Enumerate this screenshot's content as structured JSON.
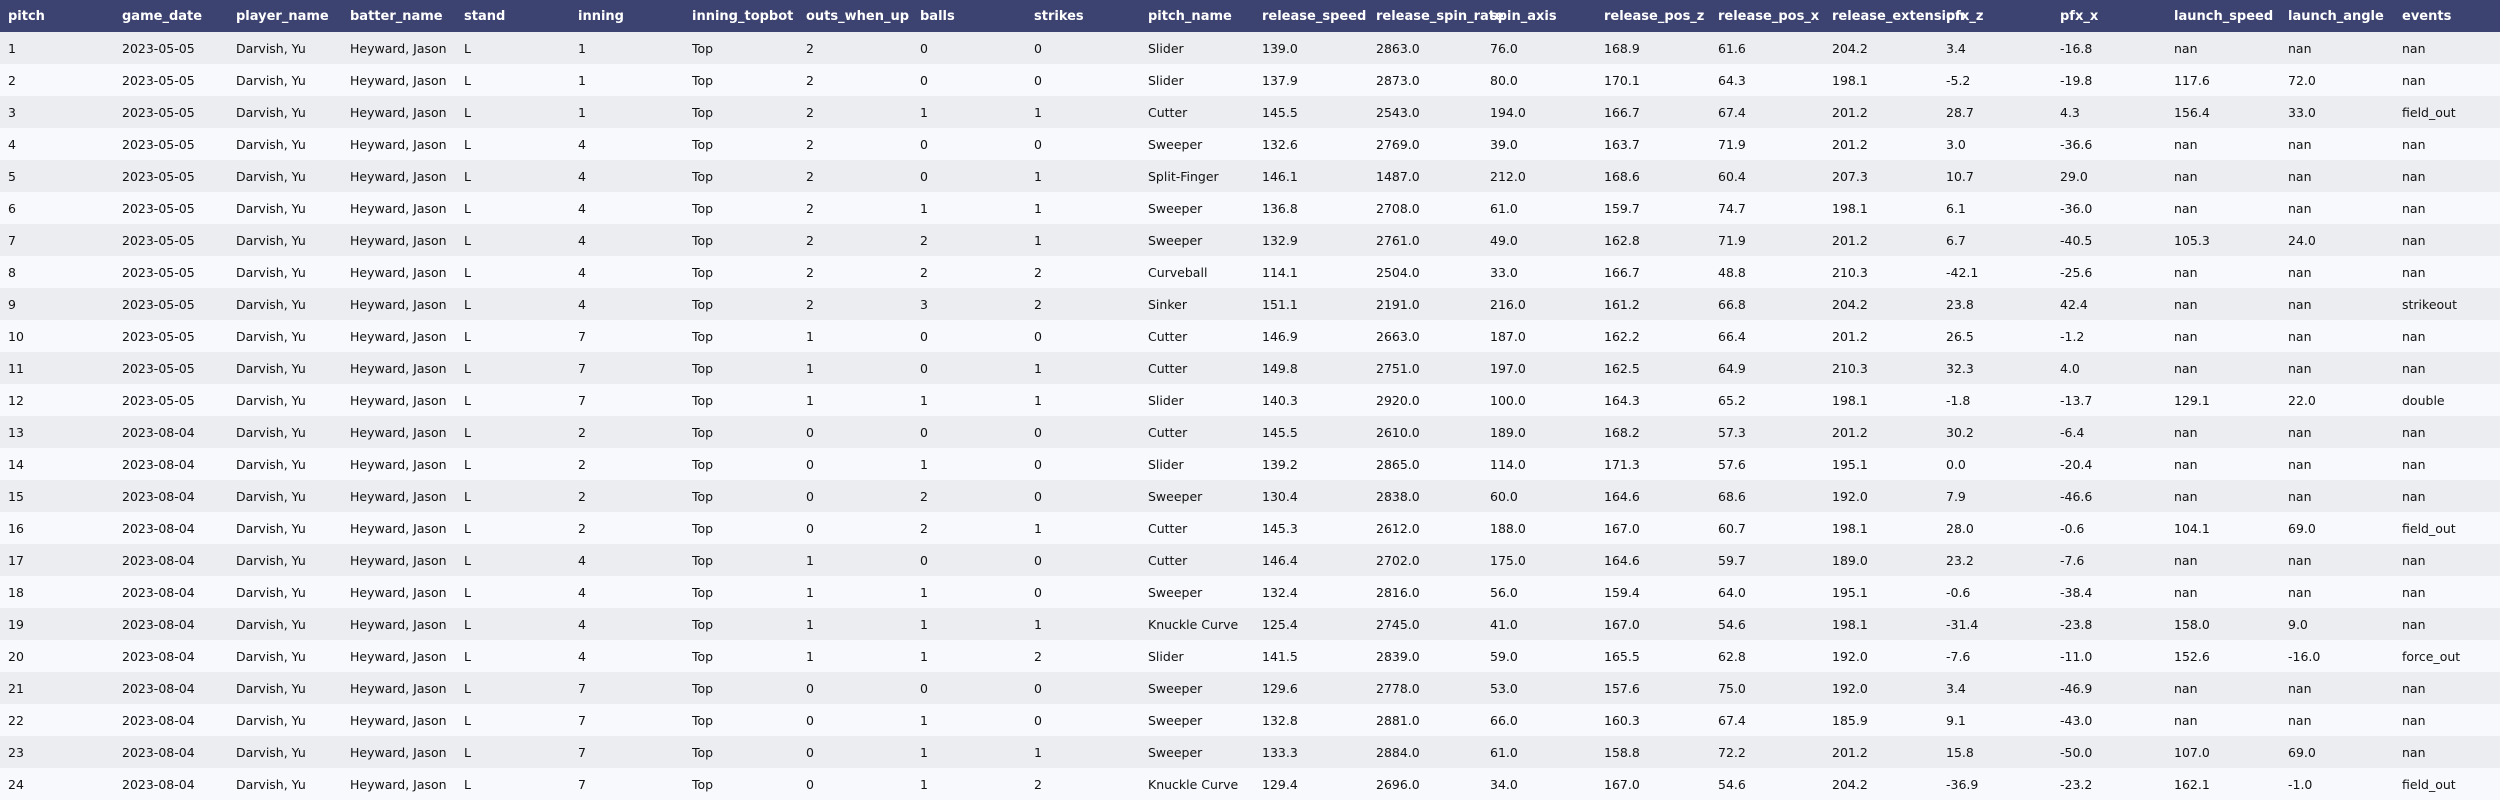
{
  "chart_data": {
    "type": "table",
    "columns": [
      "pitch",
      "game_date",
      "player_name",
      "batter_name",
      "stand",
      "inning",
      "inning_topbot",
      "outs_when_up",
      "balls",
      "strikes",
      "pitch_name",
      "release_speed",
      "release_spin_rate",
      "spin_axis",
      "release_pos_z",
      "release_pos_x",
      "release_extension",
      "pfx_z",
      "pfx_x",
      "launch_speed",
      "launch_angle",
      "events"
    ],
    "rows": [
      [
        "1",
        "2023-05-05",
        "Darvish, Yu",
        "Heyward, Jason",
        "L",
        "1",
        "Top",
        "2",
        "0",
        "0",
        "Slider",
        "139.0",
        "2863.0",
        "76.0",
        "168.9",
        "61.6",
        "204.2",
        "3.4",
        "-16.8",
        "nan",
        "nan",
        "nan"
      ],
      [
        "2",
        "2023-05-05",
        "Darvish, Yu",
        "Heyward, Jason",
        "L",
        "1",
        "Top",
        "2",
        "0",
        "0",
        "Slider",
        "137.9",
        "2873.0",
        "80.0",
        "170.1",
        "64.3",
        "198.1",
        "-5.2",
        "-19.8",
        "117.6",
        "72.0",
        "nan"
      ],
      [
        "3",
        "2023-05-05",
        "Darvish, Yu",
        "Heyward, Jason",
        "L",
        "1",
        "Top",
        "2",
        "1",
        "1",
        "Cutter",
        "145.5",
        "2543.0",
        "194.0",
        "166.7",
        "67.4",
        "201.2",
        "28.7",
        "4.3",
        "156.4",
        "33.0",
        "field_out"
      ],
      [
        "4",
        "2023-05-05",
        "Darvish, Yu",
        "Heyward, Jason",
        "L",
        "4",
        "Top",
        "2",
        "0",
        "0",
        "Sweeper",
        "132.6",
        "2769.0",
        "39.0",
        "163.7",
        "71.9",
        "201.2",
        "3.0",
        "-36.6",
        "nan",
        "nan",
        "nan"
      ],
      [
        "5",
        "2023-05-05",
        "Darvish, Yu",
        "Heyward, Jason",
        "L",
        "4",
        "Top",
        "2",
        "0",
        "1",
        "Split-Finger",
        "146.1",
        "1487.0",
        "212.0",
        "168.6",
        "60.4",
        "207.3",
        "10.7",
        "29.0",
        "nan",
        "nan",
        "nan"
      ],
      [
        "6",
        "2023-05-05",
        "Darvish, Yu",
        "Heyward, Jason",
        "L",
        "4",
        "Top",
        "2",
        "1",
        "1",
        "Sweeper",
        "136.8",
        "2708.0",
        "61.0",
        "159.7",
        "74.7",
        "198.1",
        "6.1",
        "-36.0",
        "nan",
        "nan",
        "nan"
      ],
      [
        "7",
        "2023-05-05",
        "Darvish, Yu",
        "Heyward, Jason",
        "L",
        "4",
        "Top",
        "2",
        "2",
        "1",
        "Sweeper",
        "132.9",
        "2761.0",
        "49.0",
        "162.8",
        "71.9",
        "201.2",
        "6.7",
        "-40.5",
        "105.3",
        "24.0",
        "nan"
      ],
      [
        "8",
        "2023-05-05",
        "Darvish, Yu",
        "Heyward, Jason",
        "L",
        "4",
        "Top",
        "2",
        "2",
        "2",
        "Curveball",
        "114.1",
        "2504.0",
        "33.0",
        "166.7",
        "48.8",
        "210.3",
        "-42.1",
        "-25.6",
        "nan",
        "nan",
        "nan"
      ],
      [
        "9",
        "2023-05-05",
        "Darvish, Yu",
        "Heyward, Jason",
        "L",
        "4",
        "Top",
        "2",
        "3",
        "2",
        "Sinker",
        "151.1",
        "2191.0",
        "216.0",
        "161.2",
        "66.8",
        "204.2",
        "23.8",
        "42.4",
        "nan",
        "nan",
        "strikeout"
      ],
      [
        "10",
        "2023-05-05",
        "Darvish, Yu",
        "Heyward, Jason",
        "L",
        "7",
        "Top",
        "1",
        "0",
        "0",
        "Cutter",
        "146.9",
        "2663.0",
        "187.0",
        "162.2",
        "66.4",
        "201.2",
        "26.5",
        "-1.2",
        "nan",
        "nan",
        "nan"
      ],
      [
        "11",
        "2023-05-05",
        "Darvish, Yu",
        "Heyward, Jason",
        "L",
        "7",
        "Top",
        "1",
        "0",
        "1",
        "Cutter",
        "149.8",
        "2751.0",
        "197.0",
        "162.5",
        "64.9",
        "210.3",
        "32.3",
        "4.0",
        "nan",
        "nan",
        "nan"
      ],
      [
        "12",
        "2023-05-05",
        "Darvish, Yu",
        "Heyward, Jason",
        "L",
        "7",
        "Top",
        "1",
        "1",
        "1",
        "Slider",
        "140.3",
        "2920.0",
        "100.0",
        "164.3",
        "65.2",
        "198.1",
        "-1.8",
        "-13.7",
        "129.1",
        "22.0",
        "double"
      ],
      [
        "13",
        "2023-08-04",
        "Darvish, Yu",
        "Heyward, Jason",
        "L",
        "2",
        "Top",
        "0",
        "0",
        "0",
        "Cutter",
        "145.5",
        "2610.0",
        "189.0",
        "168.2",
        "57.3",
        "201.2",
        "30.2",
        "-6.4",
        "nan",
        "nan",
        "nan"
      ],
      [
        "14",
        "2023-08-04",
        "Darvish, Yu",
        "Heyward, Jason",
        "L",
        "2",
        "Top",
        "0",
        "1",
        "0",
        "Slider",
        "139.2",
        "2865.0",
        "114.0",
        "171.3",
        "57.6",
        "195.1",
        "0.0",
        "-20.4",
        "nan",
        "nan",
        "nan"
      ],
      [
        "15",
        "2023-08-04",
        "Darvish, Yu",
        "Heyward, Jason",
        "L",
        "2",
        "Top",
        "0",
        "2",
        "0",
        "Sweeper",
        "130.4",
        "2838.0",
        "60.0",
        "164.6",
        "68.6",
        "192.0",
        "7.9",
        "-46.6",
        "nan",
        "nan",
        "nan"
      ],
      [
        "16",
        "2023-08-04",
        "Darvish, Yu",
        "Heyward, Jason",
        "L",
        "2",
        "Top",
        "0",
        "2",
        "1",
        "Cutter",
        "145.3",
        "2612.0",
        "188.0",
        "167.0",
        "60.7",
        "198.1",
        "28.0",
        "-0.6",
        "104.1",
        "69.0",
        "field_out"
      ],
      [
        "17",
        "2023-08-04",
        "Darvish, Yu",
        "Heyward, Jason",
        "L",
        "4",
        "Top",
        "1",
        "0",
        "0",
        "Cutter",
        "146.4",
        "2702.0",
        "175.0",
        "164.6",
        "59.7",
        "189.0",
        "23.2",
        "-7.6",
        "nan",
        "nan",
        "nan"
      ],
      [
        "18",
        "2023-08-04",
        "Darvish, Yu",
        "Heyward, Jason",
        "L",
        "4",
        "Top",
        "1",
        "1",
        "0",
        "Sweeper",
        "132.4",
        "2816.0",
        "56.0",
        "159.4",
        "64.0",
        "195.1",
        "-0.6",
        "-38.4",
        "nan",
        "nan",
        "nan"
      ],
      [
        "19",
        "2023-08-04",
        "Darvish, Yu",
        "Heyward, Jason",
        "L",
        "4",
        "Top",
        "1",
        "1",
        "1",
        "Knuckle Curve",
        "125.4",
        "2745.0",
        "41.0",
        "167.0",
        "54.6",
        "198.1",
        "-31.4",
        "-23.8",
        "158.0",
        "9.0",
        "nan"
      ],
      [
        "20",
        "2023-08-04",
        "Darvish, Yu",
        "Heyward, Jason",
        "L",
        "4",
        "Top",
        "1",
        "1",
        "2",
        "Slider",
        "141.5",
        "2839.0",
        "59.0",
        "165.5",
        "62.8",
        "192.0",
        "-7.6",
        "-11.0",
        "152.6",
        "-16.0",
        "force_out"
      ],
      [
        "21",
        "2023-08-04",
        "Darvish, Yu",
        "Heyward, Jason",
        "L",
        "7",
        "Top",
        "0",
        "0",
        "0",
        "Sweeper",
        "129.6",
        "2778.0",
        "53.0",
        "157.6",
        "75.0",
        "192.0",
        "3.4",
        "-46.9",
        "nan",
        "nan",
        "nan"
      ],
      [
        "22",
        "2023-08-04",
        "Darvish, Yu",
        "Heyward, Jason",
        "L",
        "7",
        "Top",
        "0",
        "1",
        "0",
        "Sweeper",
        "132.8",
        "2881.0",
        "66.0",
        "160.3",
        "67.4",
        "185.9",
        "9.1",
        "-43.0",
        "nan",
        "nan",
        "nan"
      ],
      [
        "23",
        "2023-08-04",
        "Darvish, Yu",
        "Heyward, Jason",
        "L",
        "7",
        "Top",
        "0",
        "1",
        "1",
        "Sweeper",
        "133.3",
        "2884.0",
        "61.0",
        "158.8",
        "72.2",
        "201.2",
        "15.8",
        "-50.0",
        "107.0",
        "69.0",
        "nan"
      ],
      [
        "24",
        "2023-08-04",
        "Darvish, Yu",
        "Heyward, Jason",
        "L",
        "7",
        "Top",
        "0",
        "1",
        "2",
        "Knuckle Curve",
        "129.4",
        "2696.0",
        "34.0",
        "167.0",
        "54.6",
        "204.2",
        "-36.9",
        "-23.2",
        "162.1",
        "-1.0",
        "field_out"
      ]
    ]
  },
  "colors": {
    "header_bg": "#3d4371",
    "header_text": "#ffffff",
    "row_odd": "#ecedf1",
    "row_even": "#f8f9fd"
  }
}
